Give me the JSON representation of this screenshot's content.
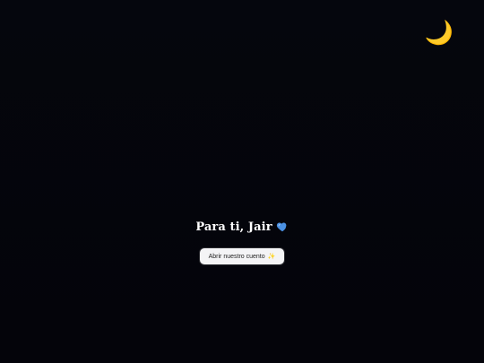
{
  "header": {
    "moon_icon": "🌙"
  },
  "hero": {
    "title": "Para ti, Jair",
    "heart_icon": "blue-heart-icon",
    "button_label": "Abrir nuestro cuento",
    "button_icon": "✨"
  },
  "colors": {
    "background": "#05060d",
    "title": "#ffffff",
    "button_bg": "#f4f4f6",
    "heart": "#4a90e2",
    "moon": "#f2c14e"
  }
}
